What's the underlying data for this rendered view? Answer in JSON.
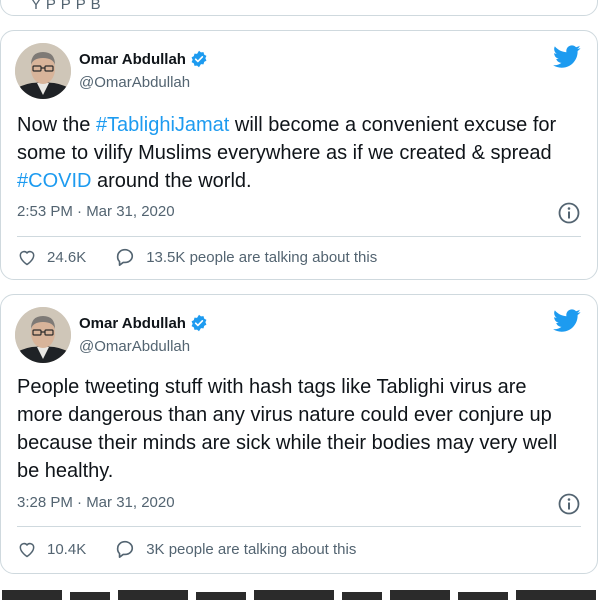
{
  "colors": {
    "accent": "#1d9bf0",
    "text": "#0f1419",
    "muted": "#536471",
    "border": "#cfd9de"
  },
  "top_card": {
    "fragment": "Y    P P   P   B"
  },
  "tweets": [
    {
      "display_name": "Omar Abdullah",
      "handle": "@OmarAbdullah",
      "text_parts": [
        {
          "text": "Now the ",
          "hashtag": false
        },
        {
          "text": "#TablighiJamat",
          "hashtag": true
        },
        {
          "text": " will become a convenient excuse for some to vilify Muslims everywhere as if we created & spread ",
          "hashtag": false
        },
        {
          "text": "#COVID",
          "hashtag": true
        },
        {
          "text": " around the world.",
          "hashtag": false
        }
      ],
      "timestamp": "2:53 PM · Mar 31, 2020",
      "likes": "24.6K",
      "talking": "13.5K people are talking about this",
      "icons": {
        "like": "heart-icon",
        "reply": "comment-icon",
        "info": "info-icon",
        "logo": "twitter-bird-icon",
        "verified": "verified-badge-icon"
      }
    },
    {
      "display_name": "Omar Abdullah",
      "handle": "@OmarAbdullah",
      "text_parts": [
        {
          "text": "People tweeting stuff with hash tags like Tablighi virus are more dangerous than any virus nature could ever conjure up because their minds are sick while their bodies may very well be healthy.",
          "hashtag": false
        }
      ],
      "timestamp": "3:28 PM · Mar 31, 2020",
      "likes": "10.4K",
      "talking": "3K people are talking about this",
      "icons": {
        "like": "heart-icon",
        "reply": "comment-icon",
        "info": "info-icon",
        "logo": "twitter-bird-icon",
        "verified": "verified-badge-icon"
      }
    }
  ]
}
